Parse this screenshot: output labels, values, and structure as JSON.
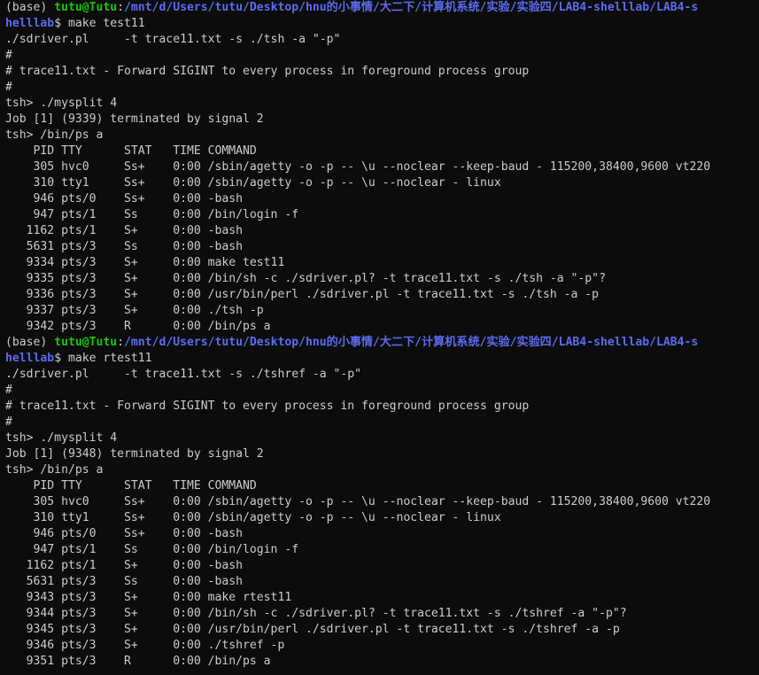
{
  "colors": {
    "background": "#0c0c0c",
    "text": "#cccccc",
    "prompt_user": "#16c60c",
    "prompt_path": "#5b6cf0"
  },
  "lines": [
    {
      "kind": "prompt-start",
      "env": "(base) ",
      "user": "tutu@Tutu",
      "sep": ":",
      "path": "/mnt/d/Users/tutu/Desktop/hnu的小事情/大二下/计算机系统/实验/实验四/LAB4-shelllab/LAB4-s"
    },
    {
      "kind": "prompt-end",
      "path": "helllab",
      "dollar": "$ ",
      "cmd": "make test11"
    },
    {
      "kind": "text",
      "text": "./sdriver.pl     -t trace11.txt -s ./tsh -a \"-p\""
    },
    {
      "kind": "text",
      "text": "#"
    },
    {
      "kind": "text",
      "text": "# trace11.txt - Forward SIGINT to every process in foreground process group"
    },
    {
      "kind": "text",
      "text": "#"
    },
    {
      "kind": "text",
      "text": "tsh> ./mysplit 4"
    },
    {
      "kind": "text",
      "text": "Job [1] (9339) terminated by signal 2"
    },
    {
      "kind": "text",
      "text": "tsh> /bin/ps a"
    },
    {
      "kind": "text",
      "text": "    PID TTY      STAT   TIME COMMAND"
    },
    {
      "kind": "text",
      "text": "    305 hvc0     Ss+    0:00 /sbin/agetty -o -p -- \\u --noclear --keep-baud - 115200,38400,9600 vt220"
    },
    {
      "kind": "text",
      "text": "    310 tty1     Ss+    0:00 /sbin/agetty -o -p -- \\u --noclear - linux"
    },
    {
      "kind": "text",
      "text": "    946 pts/0    Ss+    0:00 -bash"
    },
    {
      "kind": "text",
      "text": "    947 pts/1    Ss     0:00 /bin/login -f"
    },
    {
      "kind": "text",
      "text": "   1162 pts/1    S+     0:00 -bash"
    },
    {
      "kind": "text",
      "text": "   5631 pts/3    Ss     0:00 -bash"
    },
    {
      "kind": "text",
      "text": "   9334 pts/3    S+     0:00 make test11"
    },
    {
      "kind": "text",
      "text": "   9335 pts/3    S+     0:00 /bin/sh -c ./sdriver.pl? -t trace11.txt -s ./tsh -a \"-p\"?"
    },
    {
      "kind": "text",
      "text": "   9336 pts/3    S+     0:00 /usr/bin/perl ./sdriver.pl -t trace11.txt -s ./tsh -a -p"
    },
    {
      "kind": "text",
      "text": "   9337 pts/3    S+     0:00 ./tsh -p"
    },
    {
      "kind": "text",
      "text": "   9342 pts/3    R      0:00 /bin/ps a"
    },
    {
      "kind": "prompt-start",
      "env": "(base) ",
      "user": "tutu@Tutu",
      "sep": ":",
      "path": "/mnt/d/Users/tutu/Desktop/hnu的小事情/大二下/计算机系统/实验/实验四/LAB4-shelllab/LAB4-s"
    },
    {
      "kind": "prompt-end",
      "path": "helllab",
      "dollar": "$ ",
      "cmd": "make rtest11"
    },
    {
      "kind": "text",
      "text": "./sdriver.pl     -t trace11.txt -s ./tshref -a \"-p\""
    },
    {
      "kind": "text",
      "text": "#"
    },
    {
      "kind": "text",
      "text": "# trace11.txt - Forward SIGINT to every process in foreground process group"
    },
    {
      "kind": "text",
      "text": "#"
    },
    {
      "kind": "text",
      "text": "tsh> ./mysplit 4"
    },
    {
      "kind": "text",
      "text": "Job [1] (9348) terminated by signal 2"
    },
    {
      "kind": "text",
      "text": "tsh> /bin/ps a"
    },
    {
      "kind": "text",
      "text": "    PID TTY      STAT   TIME COMMAND"
    },
    {
      "kind": "text",
      "text": "    305 hvc0     Ss+    0:00 /sbin/agetty -o -p -- \\u --noclear --keep-baud - 115200,38400,9600 vt220"
    },
    {
      "kind": "text",
      "text": "    310 tty1     Ss+    0:00 /sbin/agetty -o -p -- \\u --noclear - linux"
    },
    {
      "kind": "text",
      "text": "    946 pts/0    Ss+    0:00 -bash"
    },
    {
      "kind": "text",
      "text": "    947 pts/1    Ss     0:00 /bin/login -f"
    },
    {
      "kind": "text",
      "text": "   1162 pts/1    S+     0:00 -bash"
    },
    {
      "kind": "text",
      "text": "   5631 pts/3    Ss     0:00 -bash"
    },
    {
      "kind": "text",
      "text": "   9343 pts/3    S+     0:00 make rtest11"
    },
    {
      "kind": "text",
      "text": "   9344 pts/3    S+     0:00 /bin/sh -c ./sdriver.pl? -t trace11.txt -s ./tshref -a \"-p\"?"
    },
    {
      "kind": "text",
      "text": "   9345 pts/3    S+     0:00 /usr/bin/perl ./sdriver.pl -t trace11.txt -s ./tshref -a -p"
    },
    {
      "kind": "text",
      "text": "   9346 pts/3    S+     0:00 ./tshref -p"
    },
    {
      "kind": "text",
      "text": "   9351 pts/3    R      0:00 /bin/ps a"
    }
  ]
}
